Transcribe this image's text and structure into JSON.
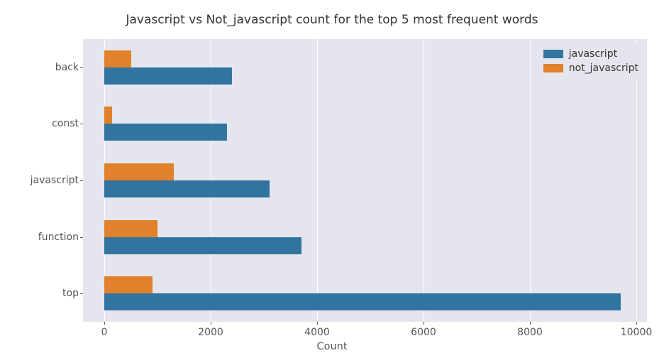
{
  "chart_data": {
    "type": "bar",
    "orientation": "horizontal",
    "title": "Javascript vs Not_javascript count for the top 5 most frequent words",
    "xlabel": "Count",
    "ylabel": "",
    "categories": [
      "top",
      "function",
      "javascript",
      "const",
      "back"
    ],
    "series": [
      {
        "name": "javascript",
        "values": [
          9700,
          3700,
          3100,
          2300,
          2400
        ]
      },
      {
        "name": "not_javascript",
        "values": [
          900,
          1000,
          1300,
          150,
          500
        ]
      }
    ],
    "xlim": [
      -400,
      10200
    ],
    "xticks": [
      0,
      2000,
      4000,
      6000,
      8000,
      10000
    ],
    "legend_position": "upper-right",
    "grid": true,
    "colors": {
      "javascript": "#3274A1",
      "not_javascript": "#E1812C"
    }
  }
}
